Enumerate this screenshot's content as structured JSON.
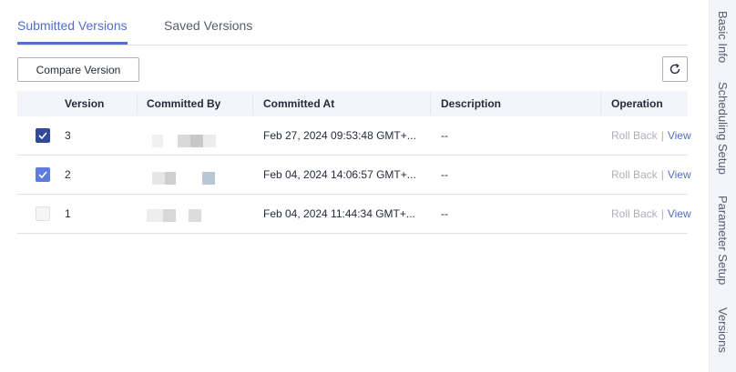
{
  "tabs": [
    {
      "label": "Submitted Versions",
      "active": true
    },
    {
      "label": "Saved Versions",
      "active": false
    }
  ],
  "toolbar": {
    "compare_label": "Compare Version",
    "refresh_icon": "refresh-icon"
  },
  "table": {
    "columns": [
      "Version",
      "Committed By",
      "Committed At",
      "Description",
      "Operation"
    ],
    "rows": [
      {
        "checked": true,
        "version": "3",
        "committed_at": "Feb 27, 2024 09:53:48 GMT+...",
        "description": "--",
        "rollback": "Roll Back",
        "view": "View"
      },
      {
        "checked": true,
        "version": "2",
        "committed_at": "Feb 04, 2024 14:06:57 GMT+...",
        "description": "--",
        "rollback": "Roll Back",
        "view": "View"
      },
      {
        "checked": false,
        "version": "1",
        "committed_at": "Feb 04, 2024 11:44:34 GMT+...",
        "description": "--",
        "rollback": "Roll Back",
        "view": "View"
      }
    ]
  },
  "side_nav": {
    "items": [
      "Basic Info",
      "Scheduling Setup",
      "Parameter Setup",
      "Versions"
    ]
  },
  "colors": {
    "accent": "#526ecc",
    "checkbox_dark": "#344899",
    "checkbox_light": "#5e7ce0",
    "disabled": "#adb0b8"
  }
}
